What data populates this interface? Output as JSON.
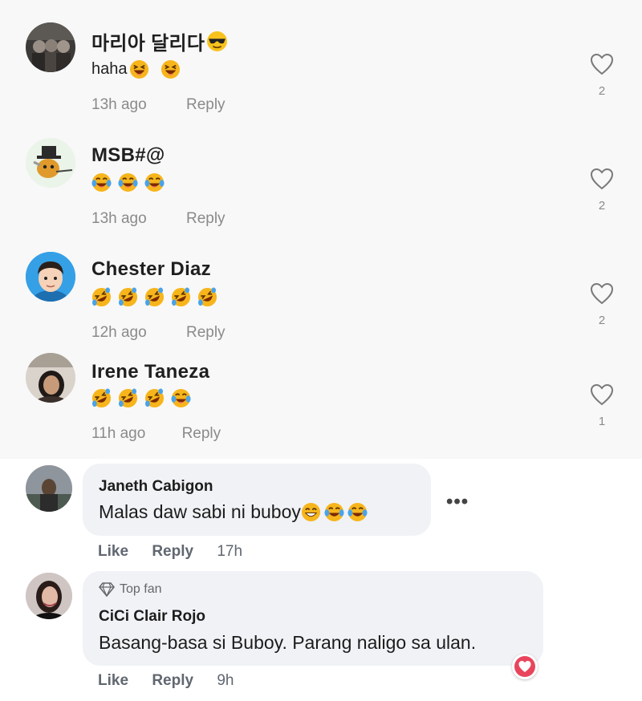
{
  "colors": {
    "tiktok_bg": "#f8f8f8",
    "fb_bubble": "#f0f2f5",
    "muted": "#8a8a8a",
    "heart_reaction": "#e8455d"
  },
  "tiktok": {
    "comments": [
      {
        "name": "마리아 달리다",
        "name_emoji": "sunglasses-face",
        "text": "haha",
        "text_emojis": [
          "squinting-laugh",
          "squinting-laugh"
        ],
        "time": "13h ago",
        "reply": "Reply",
        "likes": "2"
      },
      {
        "name": "MSB#@",
        "text": "",
        "text_emojis": [
          "tears-of-joy",
          "tears-of-joy",
          "tears-of-joy"
        ],
        "time": "13h ago",
        "reply": "Reply",
        "likes": "2"
      },
      {
        "name": "Chester Diaz",
        "text": "",
        "text_emojis": [
          "rofl",
          "rofl",
          "rofl",
          "rofl",
          "rofl"
        ],
        "time": "12h ago",
        "reply": "Reply",
        "likes": "2"
      },
      {
        "name": "Irene Taneza",
        "text": "",
        "text_emojis": [
          "rofl",
          "rofl",
          "rofl",
          "tears-of-joy"
        ],
        "time": "11h ago",
        "reply": "Reply",
        "likes": "1"
      }
    ]
  },
  "facebook": {
    "comments": [
      {
        "name": "Janeth Cabigon",
        "text": "Malas daw sabi ni buboy",
        "text_emojis": [
          "grinning-squint",
          "tears-of-joy",
          "tears-of-joy"
        ],
        "like": "Like",
        "reply": "Reply",
        "time": "17h",
        "more": "•••"
      },
      {
        "badge": "Top fan",
        "name": "CiCi Clair Rojo",
        "text": "Basang-basa si Buboy. Parang naligo sa ulan.",
        "like": "Like",
        "reply": "Reply",
        "time": "9h",
        "reaction": "love-reaction"
      }
    ]
  }
}
